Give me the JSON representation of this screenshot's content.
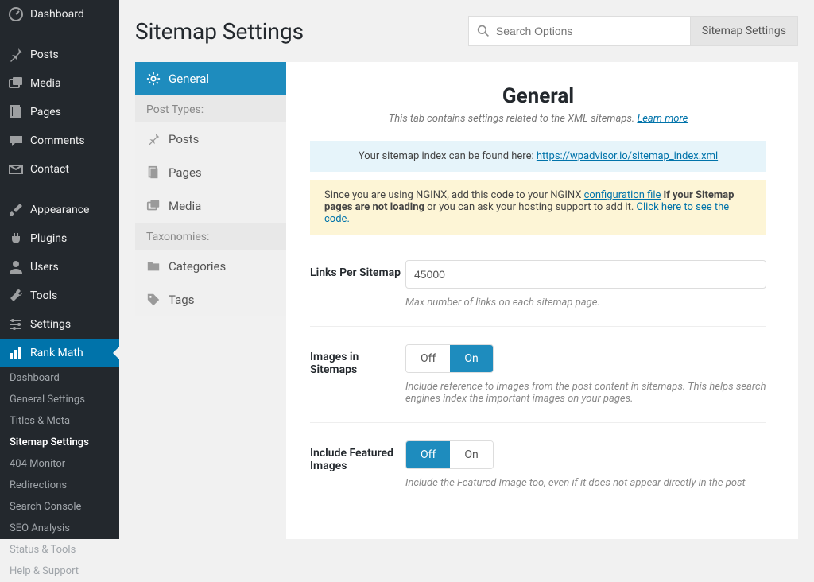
{
  "wp_sidebar": {
    "main": [
      {
        "label": "Dashboard"
      },
      {
        "label": "Posts"
      },
      {
        "label": "Media"
      },
      {
        "label": "Pages"
      },
      {
        "label": "Comments"
      },
      {
        "label": "Contact"
      },
      {
        "label": "Appearance"
      },
      {
        "label": "Plugins"
      },
      {
        "label": "Users"
      },
      {
        "label": "Tools"
      },
      {
        "label": "Settings"
      },
      {
        "label": "Rank Math"
      }
    ],
    "sub": [
      {
        "label": "Dashboard"
      },
      {
        "label": "General Settings"
      },
      {
        "label": "Titles & Meta"
      },
      {
        "label": "Sitemap Settings"
      },
      {
        "label": "404 Monitor"
      },
      {
        "label": "Redirections"
      },
      {
        "label": "Search Console"
      },
      {
        "label": "SEO Analysis"
      },
      {
        "label": "Status & Tools"
      },
      {
        "label": "Help & Support"
      }
    ]
  },
  "header": {
    "title": "Sitemap Settings",
    "search_placeholder": "Search Options",
    "breadcrumb": "Sitemap Settings"
  },
  "settings_nav": {
    "tabs_top": [
      {
        "label": "General"
      }
    ],
    "group1_label": "Post Types:",
    "group1": [
      {
        "label": "Posts"
      },
      {
        "label": "Pages"
      },
      {
        "label": "Media"
      }
    ],
    "group2_label": "Taxonomies:",
    "group2": [
      {
        "label": "Categories"
      },
      {
        "label": "Tags"
      }
    ]
  },
  "content": {
    "heading": "General",
    "subtitle_pre": "This tab contains settings related to the XML sitemaps. ",
    "subtitle_link": "Learn more",
    "notice_blue_pre": "Your sitemap index can be found here: ",
    "notice_blue_link": "https://wpadvisor.io/sitemap_index.xml",
    "notice_yellow_pre": "Since you are using NGINX, add this code to your NGINX ",
    "notice_yellow_link1": "configuration file",
    "notice_yellow_mid": " if your Sitemap pages are not loading",
    "notice_yellow_post": " or you can ask your hosting support to add it. ",
    "notice_yellow_link2": "Click here to see the code.",
    "rows": {
      "links": {
        "label": "Links Per Sitemap",
        "value": "45000",
        "help": "Max number of links on each sitemap page."
      },
      "images": {
        "label": "Images in Sitemaps",
        "off": "Off",
        "on": "On",
        "help": "Include reference to images from the post content in sitemaps. This helps search engines index the important images on your pages."
      },
      "featured": {
        "label": "Include Featured Images",
        "off": "Off",
        "on": "On",
        "help": "Include the Featured Image too, even if it does not appear directly in the post"
      }
    }
  }
}
